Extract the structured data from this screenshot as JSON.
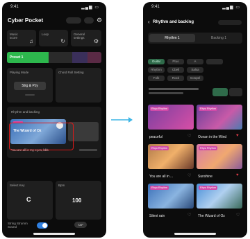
{
  "left_screen": {
    "status": {
      "time": "9:41",
      "signal": "▂▄▆ ▭"
    },
    "header": {
      "title": "Cyber Pocket",
      "icons": [
        "battery-icon",
        "volume-icon",
        "gear-icon"
      ]
    },
    "mode_buttons": [
      {
        "label": "Music score"
      },
      {
        "label": "Loop"
      },
      {
        "label": "General settings"
      }
    ],
    "preset": {
      "label": "Preset 1",
      "color": "#2db84d"
    },
    "playing_mode": {
      "title": "Playing Mode",
      "button": "Strg & Pzy"
    },
    "chord_roll": {
      "title": "Chord Roll Setting"
    },
    "rhythm": {
      "title": "Rhythm and backing",
      "card_title": "The Wizard of Oz",
      "caption": "You are all in my eyes, bbb",
      "color": "#e01818"
    },
    "select_key": {
      "title": "Select Key",
      "value": "C"
    },
    "bpm": {
      "title": "Bpm",
      "value": "100"
    },
    "bottom": {
      "label": "String Strumm Sound",
      "tap": "TAP"
    }
  },
  "right_screen": {
    "status": {
      "time": "9:41",
      "signal": "▂▄▆ ▭"
    },
    "header": {
      "title": "Rhythm and backing"
    },
    "tabs": [
      {
        "label": "Rhythm 1",
        "active": true
      },
      {
        "label": "Backing 1",
        "active": false
      }
    ],
    "filters": [
      [
        "Guitar",
        "Ptuo",
        "A"
      ],
      [
        "Rhythm",
        "Cbell",
        "Salsa"
      ],
      [
        "Folk",
        "Rock",
        "Gospel"
      ]
    ],
    "cards": [
      {
        "tag": "Rhyo Rhythm",
        "title": "peaceful",
        "heart": "empty"
      },
      {
        "tag": "Rhyo Rhythm",
        "title": "Ocean in the Wind",
        "heart": "filled"
      },
      {
        "tag": "Rhyo Rhythm",
        "title": "You are all in ...",
        "heart": "empty"
      },
      {
        "tag": "Rhyo Rhythm",
        "title": "Sunshine",
        "heart": "filled"
      },
      {
        "tag": "Rhyo Rhythm",
        "title": "Silent rain",
        "heart": "empty"
      },
      {
        "tag": "Rhyo Rhythm",
        "title": "The Wizard of Oz",
        "heart": "empty"
      }
    ],
    "accent": "#d04aa8"
  }
}
